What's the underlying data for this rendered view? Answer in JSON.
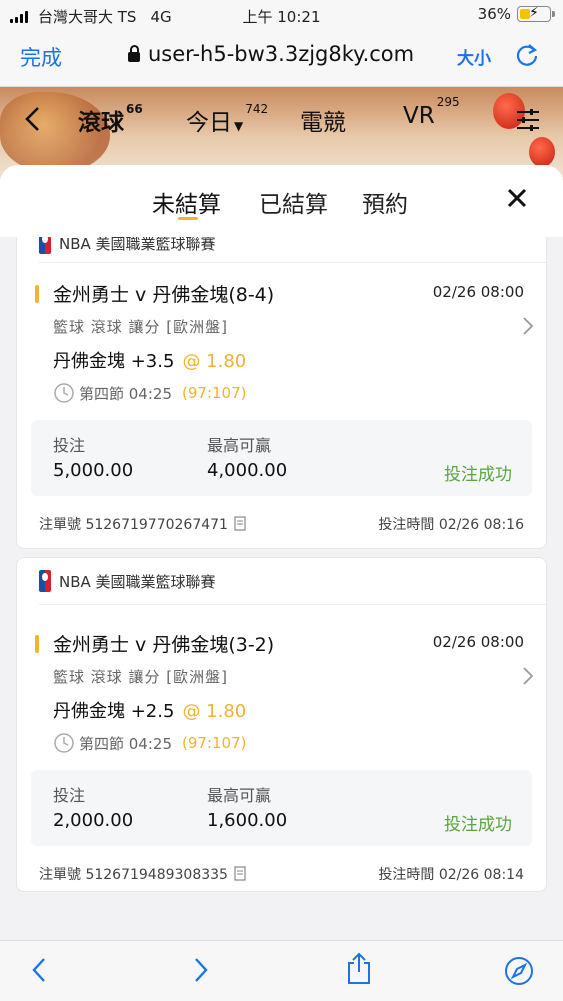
{
  "status_bar": {
    "carrier": "台灣大哥大 TS",
    "network": "4G",
    "time": "上午 10:21",
    "battery": "36%",
    "battery_level": 0.36
  },
  "browser": {
    "done_label": "完成",
    "url": "user-h5-bw3.3zjg8ky.com",
    "text_size_label": "大小"
  },
  "app_nav": {
    "tabs": [
      {
        "label": "滾球",
        "count": "66"
      },
      {
        "label": "今日",
        "count": "742"
      },
      {
        "label": "電競",
        "count": ""
      },
      {
        "label": "VR",
        "count": "295"
      }
    ]
  },
  "sheet": {
    "tabs": [
      "未結算",
      "已結算",
      "預約"
    ]
  },
  "bets": [
    {
      "league": "NBA 美國職業籃球聯賽",
      "match": "金州勇士 v 丹佛金塊(8-4)",
      "date": "02/26 08:00",
      "tags": "籃球 滾球 讓分 [歐洲盤]",
      "pick": "丹佛金塊 +3.5",
      "odds": "@ 1.80",
      "period": "第四節 04:25",
      "score": "(97:107)",
      "stake_label": "投注",
      "stake": "5,000.00",
      "max_win_label": "最高可贏",
      "max_win": "4,000.00",
      "status": "投注成功",
      "order_no": "注單號 5126719770267471",
      "bet_time": "投注時間 02/26 08:16"
    },
    {
      "league": "NBA 美國職業籃球聯賽",
      "match": "金州勇士 v 丹佛金塊(3-2)",
      "date": "02/26 08:00",
      "tags": "籃球 滾球 讓分 [歐洲盤]",
      "pick": "丹佛金塊 +2.5",
      "odds": "@ 1.80",
      "period": "第四節 04:25",
      "score": "(97:107)",
      "stake_label": "投注",
      "stake": "2,000.00",
      "max_win_label": "最高可贏",
      "max_win": "1,600.00",
      "status": "投注成功",
      "order_no": "注單號 5126719489308335",
      "bet_time": "投注時間 02/26 08:14"
    }
  ],
  "colors": {
    "accent": "#f2b233",
    "success": "#5aa63f",
    "link": "#1a73e8"
  }
}
